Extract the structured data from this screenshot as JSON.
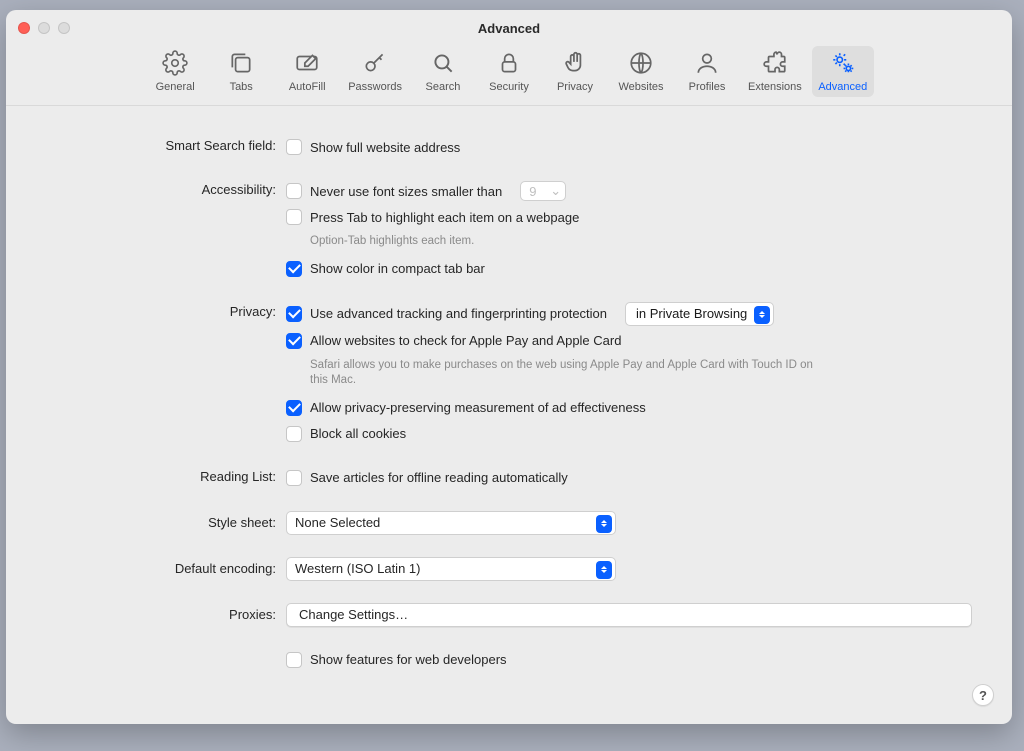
{
  "window": {
    "title": "Advanced"
  },
  "toolbar": {
    "items": [
      {
        "id": "general",
        "label": "General"
      },
      {
        "id": "tabs",
        "label": "Tabs"
      },
      {
        "id": "autofill",
        "label": "AutoFill"
      },
      {
        "id": "passwords",
        "label": "Passwords"
      },
      {
        "id": "search",
        "label": "Search"
      },
      {
        "id": "security",
        "label": "Security"
      },
      {
        "id": "privacy",
        "label": "Privacy"
      },
      {
        "id": "websites",
        "label": "Websites"
      },
      {
        "id": "profiles",
        "label": "Profiles"
      },
      {
        "id": "extensions",
        "label": "Extensions"
      },
      {
        "id": "advanced",
        "label": "Advanced"
      }
    ],
    "active": "advanced"
  },
  "sections": {
    "smart_search": {
      "label": "Smart Search field:",
      "show_full_address": "Show full website address"
    },
    "accessibility": {
      "label": "Accessibility:",
      "never_font_smaller": "Never use font sizes smaller than",
      "font_size_value": "9",
      "press_tab": "Press Tab to highlight each item on a webpage",
      "press_tab_note": "Option-Tab highlights each item.",
      "show_color_compact": "Show color in compact tab bar"
    },
    "privacy": {
      "label": "Privacy:",
      "advanced_tracking": "Use advanced tracking and fingerprinting protection",
      "advanced_tracking_scope": "in Private Browsing",
      "apple_pay": "Allow websites to check for Apple Pay and Apple Card",
      "apple_pay_note": "Safari allows you to make purchases on the web using Apple Pay and Apple Card with Touch ID on this Mac.",
      "privacy_preserving_ads": "Allow privacy-preserving measurement of ad effectiveness",
      "block_cookies": "Block all cookies"
    },
    "reading_list": {
      "label": "Reading List:",
      "save_offline": "Save articles for offline reading automatically"
    },
    "style_sheet": {
      "label": "Style sheet:",
      "value": "None Selected"
    },
    "default_encoding": {
      "label": "Default encoding:",
      "value": "Western (ISO Latin 1)"
    },
    "proxies": {
      "label": "Proxies:",
      "button": "Change Settings…"
    },
    "dev": {
      "show_dev_features": "Show features for web developers"
    }
  },
  "help_label": "?"
}
